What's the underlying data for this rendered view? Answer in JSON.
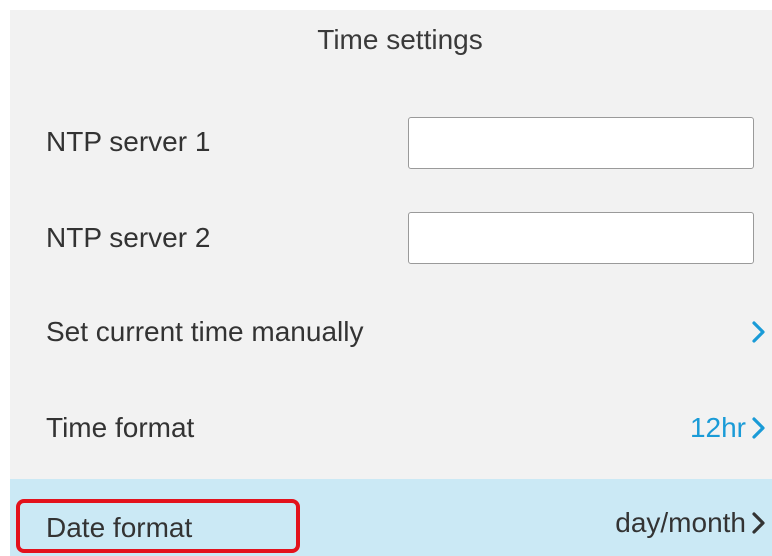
{
  "screen": {
    "title": "Time settings"
  },
  "rows": [
    {
      "label": "NTP server 1",
      "type": "text-input",
      "value": ""
    },
    {
      "label": "NTP server 2",
      "type": "text-input",
      "value": ""
    },
    {
      "label": "Set current time manually",
      "type": "link",
      "value": ""
    },
    {
      "label": "Time format",
      "type": "select",
      "value": "12hr"
    },
    {
      "label": "Date format",
      "type": "select",
      "value": "day/month",
      "selected": true
    }
  ],
  "icons": {
    "chevron": "chevron-right-icon"
  },
  "colors": {
    "accent": "#1a9bd7",
    "selected_row_bg": "#cbe9f5",
    "highlight_border": "#e3121c",
    "value_dark": "#333333"
  }
}
